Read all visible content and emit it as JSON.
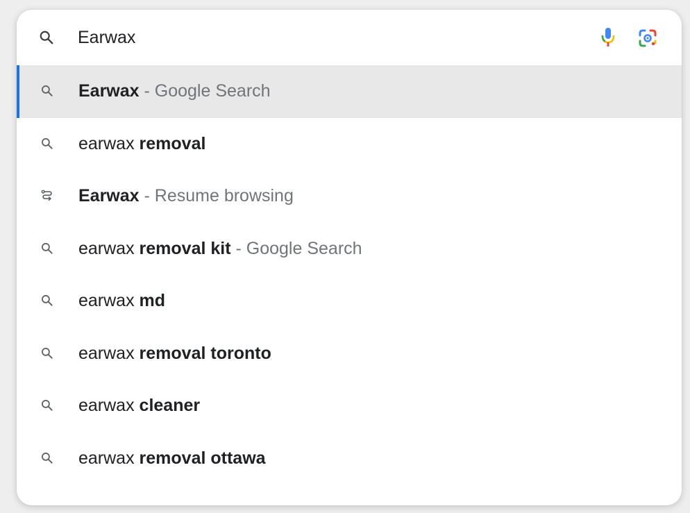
{
  "search": {
    "value": "Earwax",
    "placeholder": ""
  },
  "icons": {
    "search": "search-icon",
    "mic": "microphone-icon",
    "lens": "google-lens-icon",
    "history": "history-journey-icon"
  },
  "colors": {
    "accent": "#1a73e8",
    "selected_bg": "#e8e8e8",
    "suffix_text": "#70757a",
    "mic_blue": "#4285f4",
    "mic_red": "#ea4335",
    "mic_yellow": "#fbbc04",
    "mic_green": "#34a853"
  },
  "suggestions": [
    {
      "icon": "search-icon",
      "normal": "",
      "bold": "Earwax",
      "suffix": " - Google Search",
      "selected": true
    },
    {
      "icon": "search-icon",
      "normal": "earwax ",
      "bold": "removal",
      "suffix": "",
      "selected": false
    },
    {
      "icon": "history-journey-icon",
      "normal": "",
      "bold": "Earwax",
      "suffix": " - Resume browsing",
      "selected": false
    },
    {
      "icon": "search-icon",
      "normal": "earwax ",
      "bold": "removal kit",
      "suffix": " - Google Search",
      "selected": false
    },
    {
      "icon": "search-icon",
      "normal": "earwax ",
      "bold": "md",
      "suffix": "",
      "selected": false
    },
    {
      "icon": "search-icon",
      "normal": "earwax ",
      "bold": "removal toronto",
      "suffix": "",
      "selected": false
    },
    {
      "icon": "search-icon",
      "normal": "earwax ",
      "bold": "cleaner",
      "suffix": "",
      "selected": false
    },
    {
      "icon": "search-icon",
      "normal": "earwax ",
      "bold": "removal ottawa",
      "suffix": "",
      "selected": false
    }
  ]
}
